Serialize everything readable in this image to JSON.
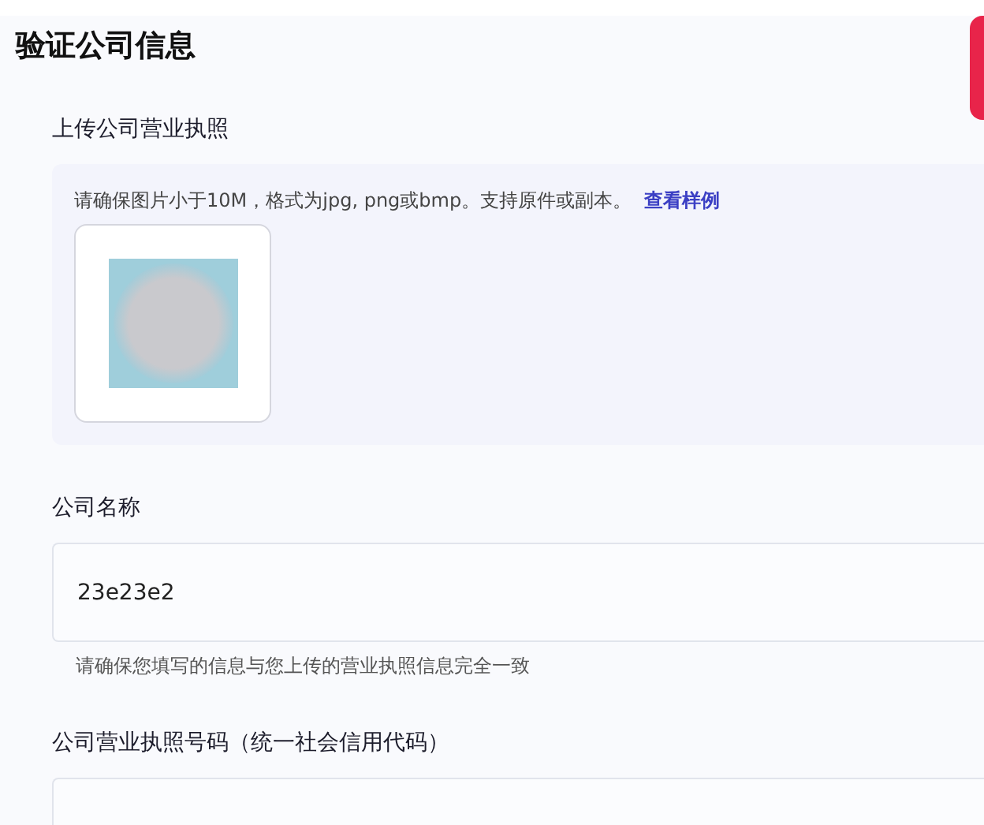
{
  "title": "验证公司信息",
  "upload": {
    "label": "上传公司营业执照",
    "hint": "请确保图片小于10M，格式为jpg, png或bmp。支持原件或副本。",
    "link": "查看样例"
  },
  "fields": [
    {
      "label": "公司名称",
      "value": "23e23e2",
      "helper": "请确保您填写的信息与您上传的营业执照信息完全一致"
    },
    {
      "label": "公司营业执照号码（统一社会信用代码）"
    }
  ]
}
